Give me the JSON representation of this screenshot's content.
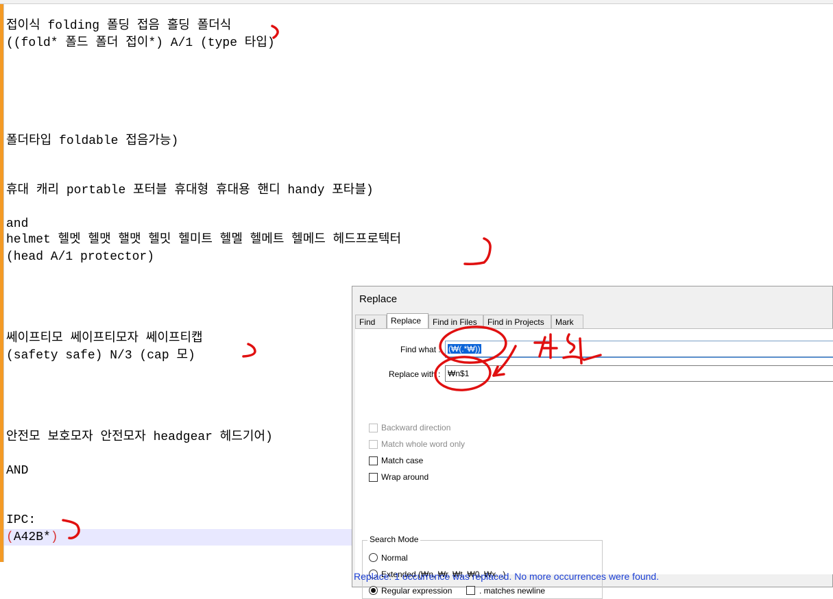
{
  "editor": {
    "lines": [
      "접이식 folding 폴딩 접음 홀딩 폴더식",
      "((fold* 폴드 폴더 접이*) A/1 (type 타입)",
      "폴더타입 foldable 접음가능)",
      "휴대 캐리 portable 포터블 휴대형 휴대용 핸디 handy 포타블)",
      "and",
      "helmet 헬멧 헬맷 핼맷 헬밋 헬미트 헬멜 헬메트 헬메드 헤드프로텍터",
      "(head A/1 protector)",
      "쎄이프티모 쎄이프티모자 쎄이프티캡",
      "(safety safe) N/3 (cap 모)",
      "안전모 보호모자 안전모자 headgear 헤드기어)",
      "AND",
      "IPC:"
    ],
    "last_line": {
      "open_paren": "(",
      "text": "A42B*",
      "close_paren": ")"
    },
    "handwritten_note": "치환"
  },
  "dialog": {
    "title": "Replace",
    "tabs": [
      "Find",
      "Replace",
      "Find in Files",
      "Find in Projects",
      "Mark"
    ],
    "active_tab": "Replace",
    "find_label": "Find what :",
    "find_value": "(₩(.*₩))",
    "replace_label": "Replace with :",
    "replace_value": "₩n$1",
    "options": {
      "backward": "Backward direction",
      "whole_word": "Match whole word only",
      "match_case": "Match case",
      "wrap": "Wrap around"
    },
    "search_mode": {
      "title": "Search Mode",
      "normal": "Normal",
      "extended": "Extended (₩n, ₩r, ₩t, ₩0, ₩x...)",
      "regex": "Regular expression",
      "matches_newline": ". matches newline"
    },
    "status": "Replace: 1 occurrence was replaced. No more occurrences were found."
  },
  "colors": {
    "gutter": "#f39a25",
    "annotation": "#e01010",
    "selection": "#0a64d8",
    "status": "#1b3fd6"
  }
}
